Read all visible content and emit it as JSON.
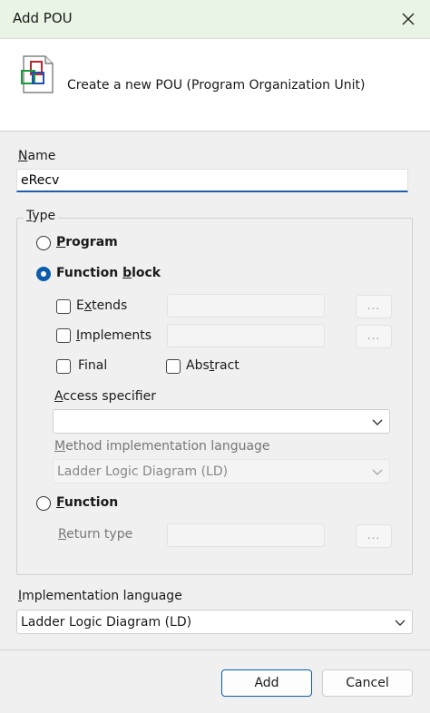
{
  "window": {
    "title": "Add POU"
  },
  "header": {
    "description": "Create a new POU (Program Organization Unit)",
    "icon": "pou-icon"
  },
  "name": {
    "label": "Name",
    "value": "eRecv"
  },
  "type": {
    "legend": "Type",
    "program": {
      "label": "Program",
      "selected": false
    },
    "function_block": {
      "label": "Function block",
      "selected": true,
      "extends": {
        "label": "Extends",
        "checked": false,
        "value": ""
      },
      "implements": {
        "label": "Implements",
        "checked": false,
        "value": ""
      },
      "browse_label": "...",
      "final": {
        "label": "Final",
        "checked": false
      },
      "abstract": {
        "label": "Abstract",
        "checked": false
      },
      "access_specifier": {
        "label": "Access specifier",
        "value": ""
      },
      "method_impl_language": {
        "label": "Method implementation language",
        "value": "Ladder Logic Diagram (LD)"
      }
    },
    "function": {
      "label": "Function",
      "selected": false,
      "return_type": {
        "label": "Return type",
        "value": ""
      }
    }
  },
  "implementation_language": {
    "label": "Implementation language",
    "value": "Ladder Logic Diagram (LD)"
  },
  "buttons": {
    "add": "Add",
    "cancel": "Cancel"
  },
  "colors": {
    "accent": "#0b5cad",
    "titlebar": "#e9f4e4"
  }
}
